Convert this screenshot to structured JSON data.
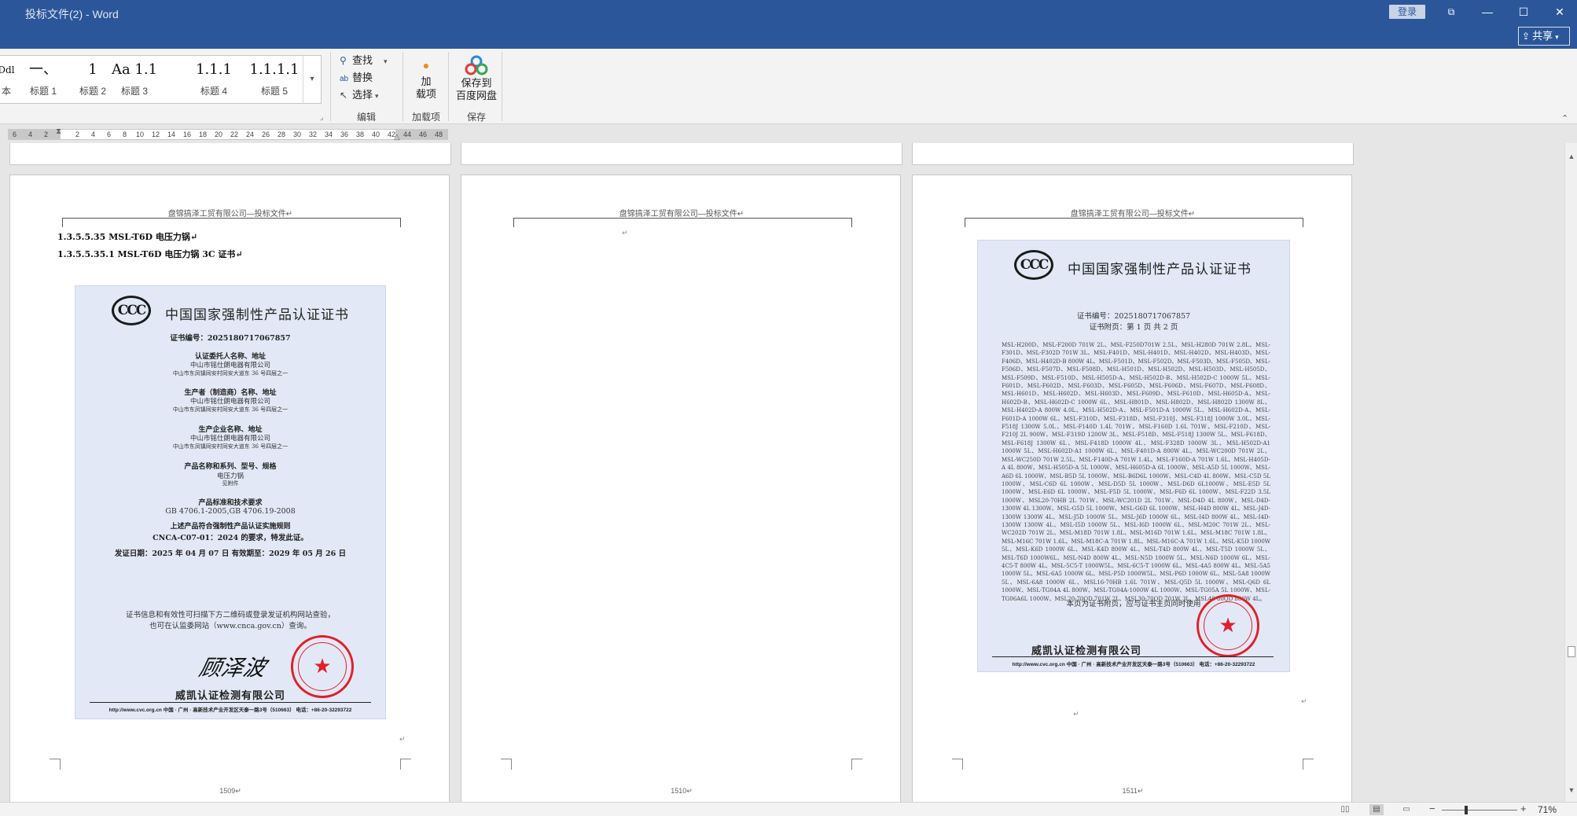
{
  "window": {
    "title": "投标文件(2)  -  Word",
    "login_label": "登录",
    "share_label": "共享",
    "controls": {
      "restore": "⧉",
      "minimize": "—",
      "maximize": "☐",
      "close": "✕"
    }
  },
  "ribbon": {
    "styles": [
      {
        "preview": "Ddl",
        "label": "本"
      },
      {
        "preview": "一、",
        "label": "标题 1"
      },
      {
        "preview": "1",
        "label": "标题 2"
      },
      {
        "preview": "Aa 1.1",
        "label": "标题 3"
      },
      {
        "preview": "1.1.1",
        "label": "标题 4"
      },
      {
        "preview": "1.1.1.1",
        "label": "标题 5"
      }
    ],
    "editing": {
      "find": "查找",
      "replace": "替换",
      "select": "选择",
      "group_label": "编辑"
    },
    "addin": {
      "label_line1": "加",
      "label_line2": "载项",
      "group_label": "加载项"
    },
    "save": {
      "label_line1": "保存到",
      "label_line2": "百度网盘",
      "group_label": "保存"
    }
  },
  "ruler": {
    "ticks": [
      "6",
      "4",
      "2",
      "2",
      "4",
      "6",
      "8",
      "10",
      "12",
      "14",
      "16",
      "18",
      "20",
      "22",
      "24",
      "26",
      "28",
      "30",
      "32",
      "34",
      "36",
      "38",
      "40",
      "42",
      "44",
      "46",
      "48"
    ]
  },
  "pages": [
    {
      "header": "盘锦搞泽工贸有限公司—投标文件↵",
      "headings": [
        "1.3.5.5.35 MSL-T6D 电压力锅↵",
        "1.3.5.5.35.1  MSL-T6D 电压力锅 3C 证书↵"
      ],
      "page_number": "1509↵",
      "certificate": {
        "logo": "CCC",
        "title": "中国国家强制性产品认证证书",
        "cert_no": "证书编号：2025180717067857",
        "applicant_h": "认证委托人名称、地址",
        "applicant_name": "中山市铭仕朗电器有限公司",
        "applicant_addr": "中山市东凤镇同安村同安大道东 36 号四层之一",
        "maker_h": "生产者（制造商）名称、地址",
        "maker_name": "中山市铭仕朗电器有限公司",
        "maker_addr": "中山市东凤镇同安村同安大道东 36 号四层之一",
        "factory_h": "生产企业名称、地址",
        "factory_name": "中山市铭仕朗电器有限公司",
        "factory_addr": "中山市东凤镇同安村同安大道东 36 号四层之一",
        "product_h": "产品名称和系列、型号、规格",
        "product_name": "电压力锅",
        "product_note": "见附件",
        "std_h": "产品标准和技术要求",
        "std": "GB 4706.1-2005,GB 4706.19-2008",
        "rule_1": "上述产品符合强制性产品认证实施规则",
        "rule_2": "CNCA-C07-01：2024 的要求，特发此证。",
        "dates": "发证日期：2025 年 04 月 07 日    有效期至：2029 年 05 月 26 日",
        "verify_1": "证书信息和有效性可扫描下方二维码或登录发证机构网站查验，",
        "verify_2": "也可在认监委网站（www.cnca.gov.cn）查询。",
        "signature": "顾泽波",
        "issuer": "威凯认证检测有限公司",
        "footer": "http://www.cvc.org.cn  中国 · 广州 · 高新技术产业开发区天泰一路3号（510663） 电话：+86-20-32293722"
      }
    },
    {
      "header": "盘锦搞泽工贸有限公司—投标文件↵",
      "paragraph_mark": "↵",
      "page_number": "1510↵"
    },
    {
      "header": "盘锦搞泽工贸有限公司—投标文件↵",
      "page_number": "1511↵",
      "certificate": {
        "logo": "CCC",
        "title": "中国国家强制性产品认证证书",
        "cert_no": "证书编号：2025180717067857",
        "attach": "证书附页：第 1 页  共 2 页",
        "models": "MSL-H200D、MSL-F200D 701W 2L、MSL-F250D701W 2.5L、MSL-H280D 701W 2.8L、MSL-F301D、MSL-F302D 701W 3L、MSL-F401D、MSL-H401D、MSL-H402D、MSL-H403D、MSL-F406D、MSL-H402D-B 800W 4L、MSL-F501D、MSL-F502D、MSL-F503D、MSL-F505D、MSL-F506D、MSL-F507D、MSL-F508D、MSL-H501D、MSL-H502D、MSL-H503D、MSL-H505D、MSL-F509D、MSL-F510D、MSL-H505D-A、MSL-H502D-B、MSL-H502D-C 1000W 5L、MSL-F601D、MSL-F602D、MSL-F603D、MSL-F605D、MSL-F606D、MSL-F607D、MSL-F608D、MSL-H601D、MSL-H602D、MSL-H603D、MSL-F609D、MSL-F610D、MSL-H605D-A、MSL-H602D-B、MSL-H602D-C 1000W 6L、MSL-H801D、MSL-H802D、MSL-H802D 1300W 8L、MSL-H402D-A 800W 4.0L、MSL-H502D-A、MSL-F501D-A 1000W 5L、MSL-H602D-A、MSL-F601D-A 1000W 6L、MSL-F310D、MSL-F318D、MSL-F310J、MSL-F318J 1000W 3.0L、MSL-F518J 1300W 5.0L、MSL-F140D 1.4L 701W、MSL-F160D 1.6L 701W、MSL-F210D、MSL-F210J 2L 900W、MSL-F319D 1200W 3L、MSL-F518D、MSL-F518J 1300W 5L、MSL-F618D、MSL-F618J 1300W 6L、MSL-F418D 1000W 4L、MSL-F328D 1000W 3L、MSL-H502D-A1 1000W 5L、MSL-H602D-A1 1000W 6L、MSL-F401D-A 800W 4L、MSL-WC200D 701W 2L、MSL-WC250D 701W 2.5L、MSL-F140D-A 701W 1.4L、MSL-F160D-A 701W 1.6L、MSL-H405D-A 4L 800W、MSL-H505D-A 5L 1000W、MSL-H605D-A 6L 1000W、MSL-A5D 5L 1000W、MSL-A6D 6L 1000W、MSL-B5D 5L 1000W、MSL-B6D6L 1000W、MSL-C4D 4L 800W、MSL-C5D 5L 1000W、MSL-C6D 6L 1000W、MSL-D5D 5L 1000W、MSL-D6D 6L1000W、MSL-E5D 5L 1000W、MSL-E6D 6L 1000W、MSL-F5D 5L 1000W、MSL-F6D 6L 1000W、MSL-F22D 3.5L 1000W、MSL20-70HB 2L 701W、MSL-WC201D 2L 701W、MSL-D4D 4L 800W、MSL-D4D-1300W 4L 1300W、MSL-G5D 5L 1000W、MSL-G6D 6L 1000W、MSL-H4D 800W 4L、MSL-J4D-1300W 1300W 4L、MSL-J5D 1000W 5L、MSL-J6D 1000W 6L、MSL-I4D 800W 4L、MSL-I4D-1300W 1300W 4L、MSL-I5D 1000W 5L、MSL-I6D 1000W 6L、MSL-M20C 701W 2L、MSL-WC202D 701W 2L、MSL-M18D 701W 1.8L、MSL-M16D 701W 1.6L、MSL-M18C 701W 1.8L、MSL-M16C 701W 1.6L、MSL-M18C-A 701W 1.8L、MSL-M16C-A 701W 1.6L、MSL-K5D 1000W 5L、MSL-K6D 1000W 6L、MSL-K4D 800W 4L、MSL-T4D 800W 4L、MSL-T5D 1000W 5L、MSL-T6D 1000W6L、MSL-N4D 800W 4L、MSL-N5D 1000W 5L、MSL-N6D 1000W 6L、MSL-4C5-T 800W 4L、MSL-5C5-T 1000W5L、MSL-6C5-T 1000W 6L、MSL-4A5 800W 4L、MSL-5A5 1000W 5L、MSL-6A5 1000W 6L、MSL-P5D 1000W5L、MSL-P6D 1000W 6L、MSL-5A8 1000W 5L、MSL-6A8 1000W 6L、MSL16-70HB 1.6L 701W、MSL-Q5D 5L 1000W、MSL-Q6D 6L 1000W、MSL-TG04A 4L 800W、MSL-TG04A-1000W 4L 1000W、MSL-TG05A 5L 1000W、MSL-TG06A6L 1000W、MSL20-70QD 701W 2L、MSL30-70QD 701W 3L、MSL40-80QD 800W 4L。",
        "note": "本页为证书附页，应与证书主页同时使用",
        "issuer": "威凯认证检测有限公司",
        "footer": "http://www.cvc.org.cn  中国 · 广州 · 高新技术产业开发区天泰一路3号（510663） 电话：+86-20-32293722"
      },
      "paragraph_marks": [
        "↵",
        "↵"
      ]
    }
  ],
  "statusbar": {
    "zoom": "71%",
    "zoom_minus": "−",
    "zoom_plus": "+"
  }
}
